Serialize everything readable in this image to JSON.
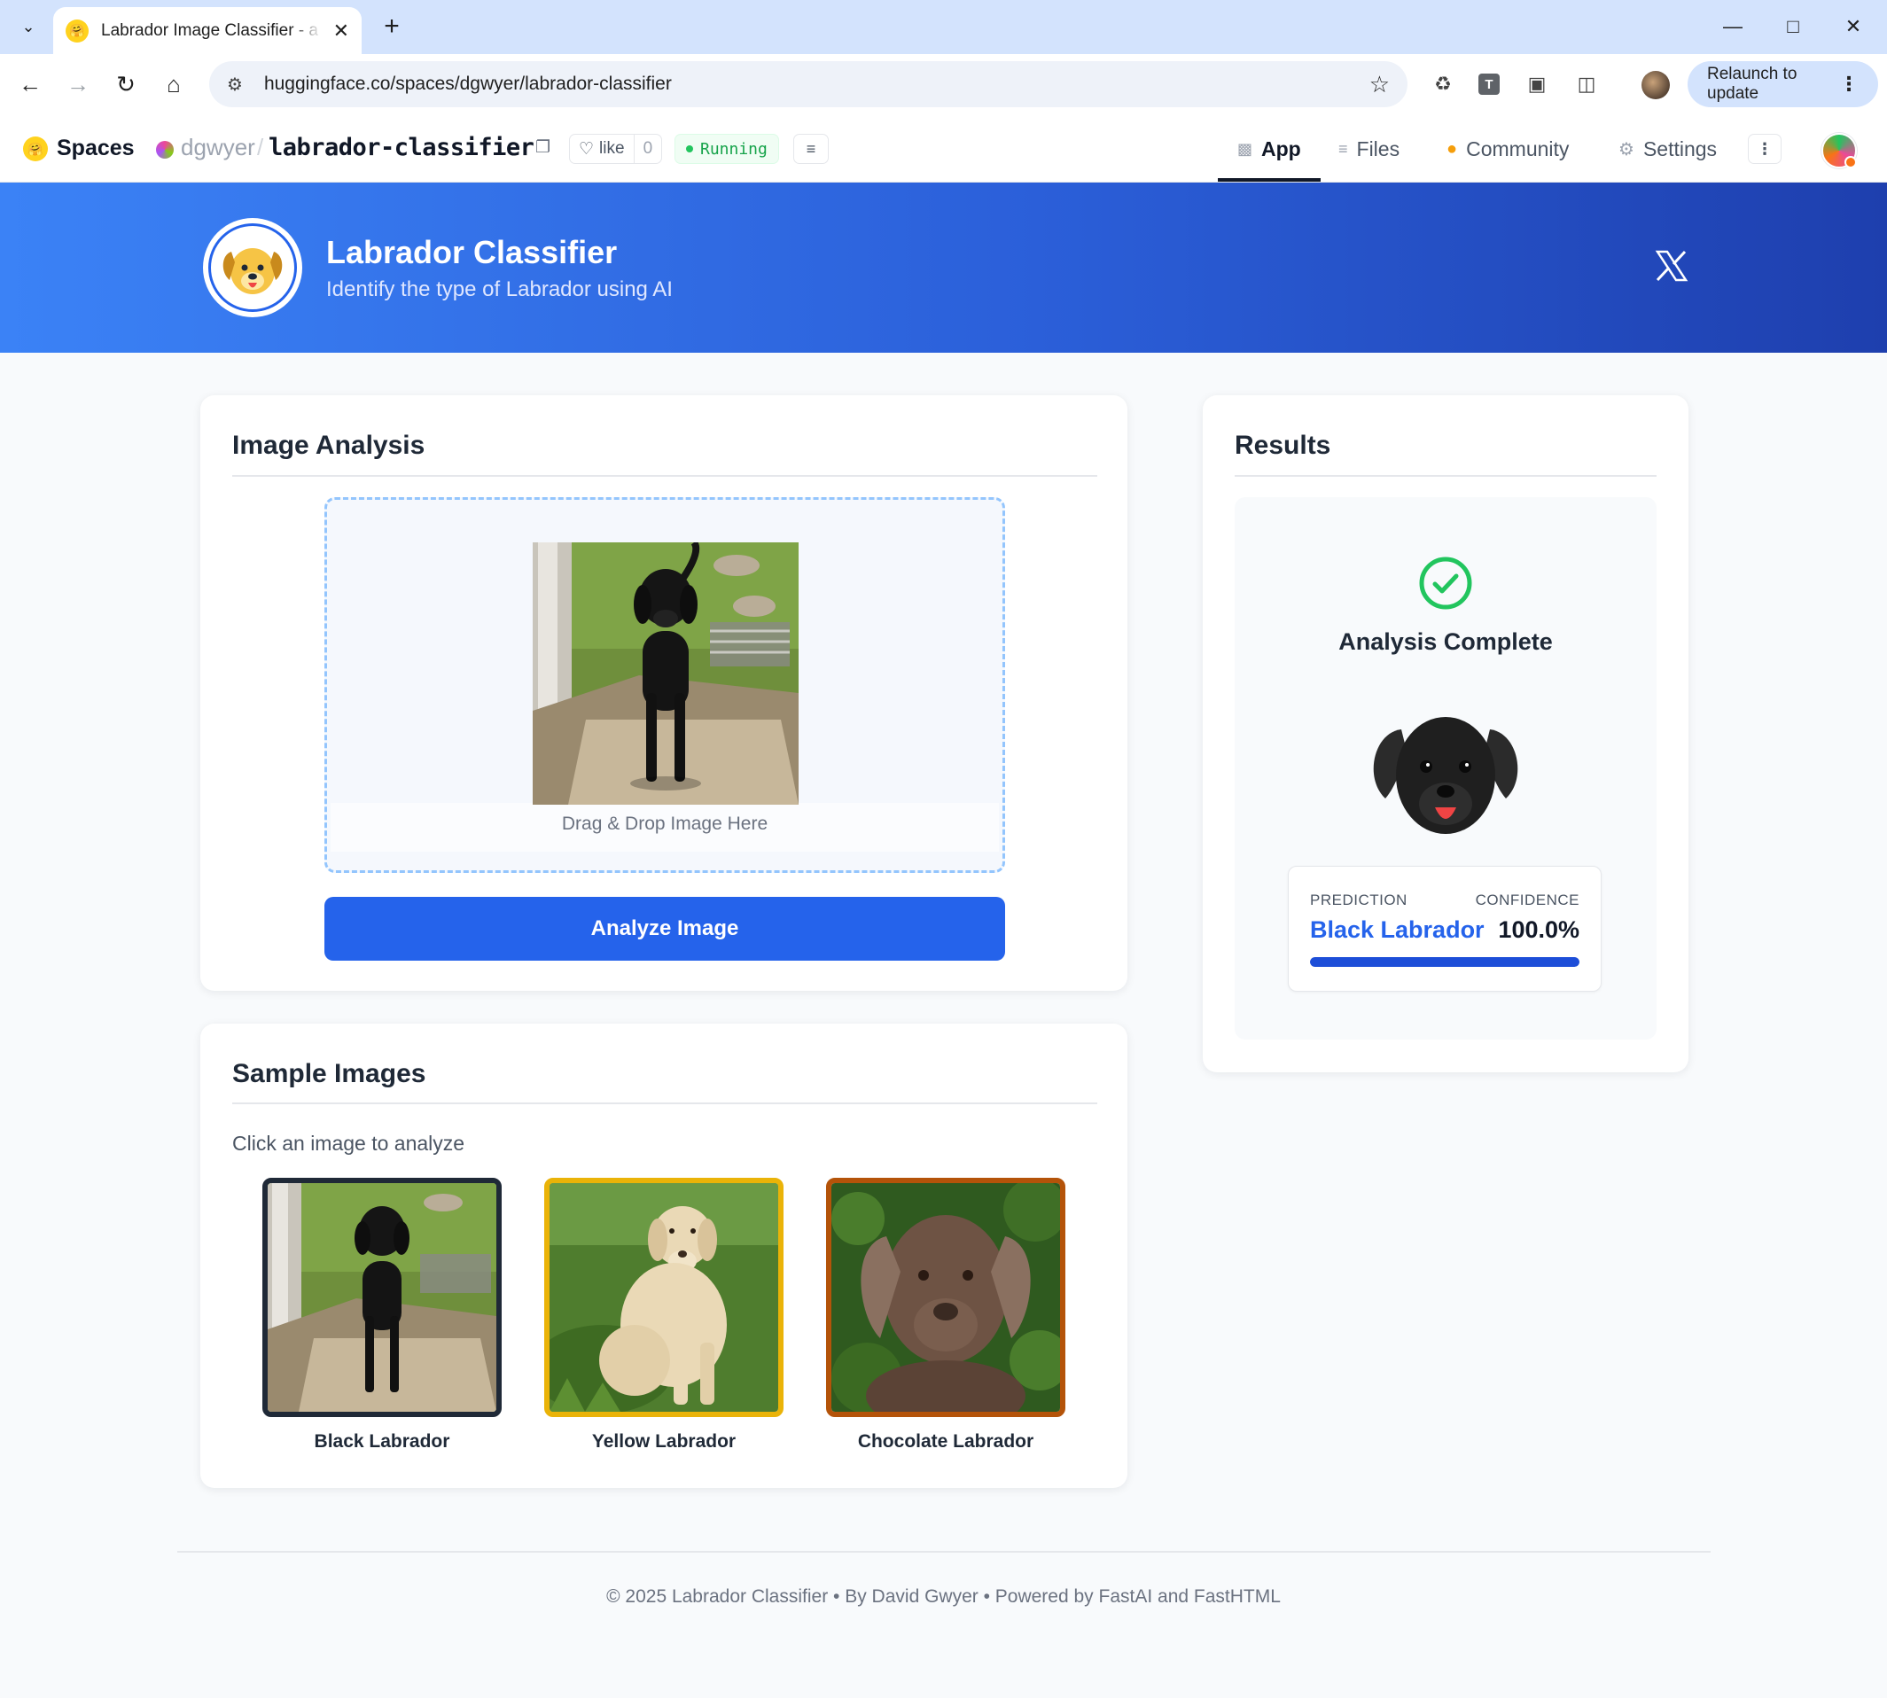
{
  "browser": {
    "tab_title": "Labrador Image Classifier - a Hugging Face Space",
    "url": "huggingface.co/spaces/dgwyer/labrador-classifier",
    "relaunch_label": "Relaunch to update",
    "ext_t_label": "T"
  },
  "hf": {
    "spaces_label": "Spaces",
    "owner": "dgwyer",
    "repo": "labrador-classifier",
    "like_label": "like",
    "like_count": "0",
    "status": "Running",
    "tabs": [
      {
        "label": "App",
        "icon": "cube-icon"
      },
      {
        "label": "Files",
        "icon": "files-icon"
      },
      {
        "label": "Community",
        "icon": "community-icon"
      },
      {
        "label": "Settings",
        "icon": "gear-icon"
      }
    ]
  },
  "banner": {
    "title": "Labrador Classifier",
    "subtitle": "Identify the type of Labrador using AI"
  },
  "analysis": {
    "title": "Image Analysis",
    "drop_label": "Drag & Drop Image Here",
    "analyze_button": "Analyze Image"
  },
  "samples": {
    "title": "Sample Images",
    "subtitle": "Click an image to analyze",
    "items": [
      {
        "label": "Black Labrador",
        "border": "#1f2937"
      },
      {
        "label": "Yellow Labrador",
        "border": "#eab308"
      },
      {
        "label": "Chocolate Labrador",
        "border": "#b45309"
      }
    ]
  },
  "results": {
    "title": "Results",
    "status": "Analysis Complete",
    "prediction_label": "PREDICTION",
    "confidence_label": "CONFIDENCE",
    "prediction": "Black Labrador",
    "confidence": "100.0%",
    "confidence_fraction": 1.0
  },
  "footer": {
    "text": "© 2025 Labrador Classifier • By David Gwyer • Powered by FastAI and FastHTML"
  },
  "colors": {
    "primary": "#2563eb",
    "success": "#22c55e",
    "running": "#16a34a"
  }
}
